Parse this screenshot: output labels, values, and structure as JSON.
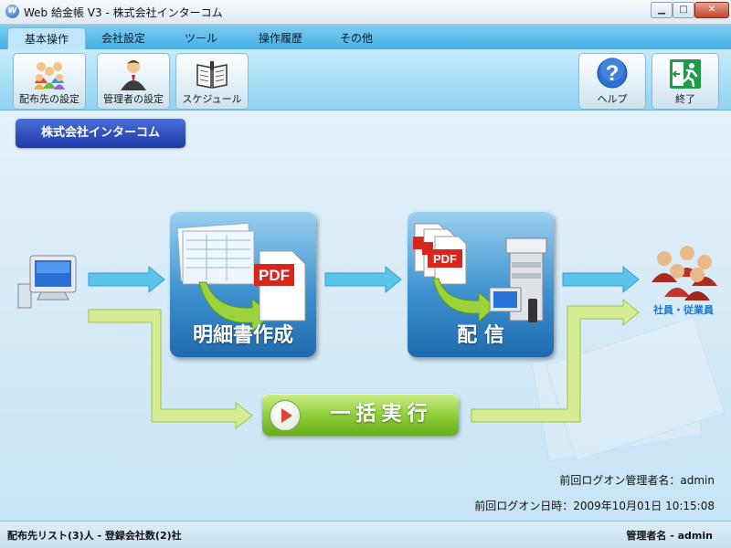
{
  "window": {
    "title": "Web 給金帳 V3 - 株式会社インターコム",
    "app_icon": "W",
    "minimize": "▁",
    "maximize": "□",
    "close": "✕"
  },
  "tabs": [
    {
      "label": "基本操作",
      "active": true
    },
    {
      "label": "会社設定"
    },
    {
      "label": "ツール"
    },
    {
      "label": "操作履歴"
    },
    {
      "label": "その他"
    }
  ],
  "toolbar": {
    "distribution_settings": "配布先の設定",
    "admin_settings": "管理者の設定",
    "schedule": "スケジュール",
    "help": "ヘルプ",
    "exit": "終了"
  },
  "company_badge": "株式会社インターコム",
  "workflow": {
    "create_statements": "明細書作成",
    "deliver": "配 信",
    "batch_execute": "一括実行",
    "employees_label": "社員・従業員",
    "pdf": "PDF"
  },
  "info": {
    "last_logon_admin": "前回ログオン管理者名：admin",
    "last_logon_datetime": "前回ログオン日時：2009年10月01日  10:15:08"
  },
  "status": {
    "left": "配布先リスト(3)人 - 登録会社数(2)社",
    "right": "管理者名 - admin"
  },
  "colors": {
    "tab_strip": "#42b0e6",
    "tile_blue": "#3e92cf",
    "exec_green": "#8fcf3a",
    "badge_blue": "#1d38a8",
    "arrow_blue": "#5cc4ec",
    "arrow_green": "#c7e27a"
  }
}
